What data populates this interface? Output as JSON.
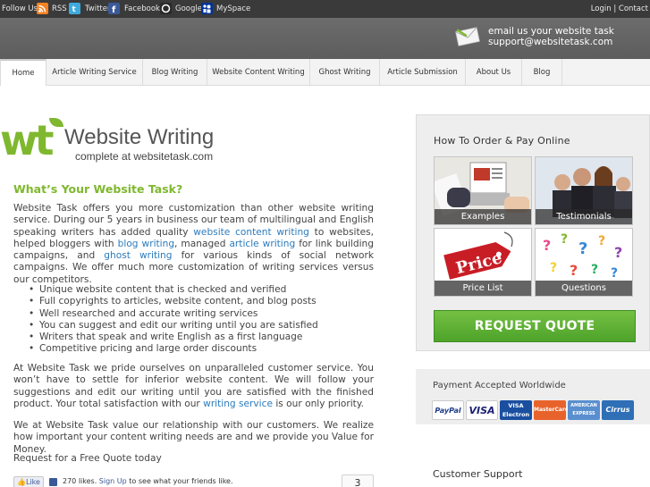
{
  "topbar": {
    "follow_label": "Follow Us:",
    "links": [
      {
        "icon": "rss-icon",
        "label": "RSS",
        "color": "#f58220"
      },
      {
        "icon": "twitter-icon",
        "label": "Twitter",
        "color": "#3fa9de"
      },
      {
        "icon": "facebook-icon",
        "label": "Facebook",
        "color": "#3b5998"
      },
      {
        "icon": "google-icon",
        "label": "Google",
        "color": "#2a2a2a"
      },
      {
        "icon": "myspace-icon",
        "label": "MySpace",
        "color": "#003399"
      }
    ],
    "login": "Login",
    "separator": "|",
    "contact": "Contact"
  },
  "header": {
    "email_line1": "email us your website task",
    "email_line2": "support@websitetask.com"
  },
  "nav": {
    "tabs": [
      {
        "label": "Home",
        "active": true
      },
      {
        "label": "Article Writing Service"
      },
      {
        "label": "Blog Writing"
      },
      {
        "label": "Website Content Writing"
      },
      {
        "label": "Ghost Writing"
      },
      {
        "label": "Article Submission"
      },
      {
        "label": "About Us"
      },
      {
        "label": "Blog"
      }
    ]
  },
  "logo": {
    "mark": "wt",
    "name": "Website Writing",
    "sub": "complete at websitetask.com"
  },
  "main": {
    "heading": "What’s Your Website Task?",
    "p1": {
      "t1": "Website Task offers you more customization than other website writing service. During our 5 years in business our team of multilingual and English speaking writers has added quality ",
      "l1": "website content writing",
      "t2": " to websites, helped bloggers with ",
      "l2": "blog writing",
      "t3": ", managed ",
      "l3": "article writing",
      "t4": " for link building campaigns, and ",
      "l4": "ghost writing",
      "t5": " for various kinds of social network campaigns. We offer much more customization of writing services versus our competitors."
    },
    "bullets": [
      "Unique website content that is checked and verified",
      "Full copyrights to articles, website content, and blog posts",
      "Well researched and accurate writing services",
      "You can suggest and edit our writing until you are satisfied",
      "Writers that speak and write English as a first language",
      "Competitive pricing and large order discounts"
    ],
    "p2": {
      "t1": "At Website Task we pride ourselves on unparalleled customer service. You won’t have to settle for inferior website content. We will follow your suggestions and edit our writing until you are satisfied with the finished product. Your total satisfaction with our ",
      "l1": "writing service",
      "t2": " is our only priority."
    },
    "p3": "We at Website Task value our relationship with our customers. We realize how important your content writing needs are and we provide you Value for Money.",
    "p4": "Request for a Free Quote today",
    "like": {
      "button": "Like",
      "count_text": "270 likes.",
      "signup": "Sign Up",
      "rest": "to see what your friends like.",
      "counter": "3"
    }
  },
  "sidebar": {
    "title": "How To Order & Pay Online",
    "tiles": [
      "Examples",
      "Testimonials",
      "Price List",
      "Questions"
    ],
    "price_tag": "Price",
    "request_button": "REQUEST QUOTE",
    "payment_title": "Payment Accepted Worldwide",
    "cards": [
      {
        "label": "PayPal",
        "color": "#ffffff",
        "text_color": "#1f3c88"
      },
      {
        "label": "VISA",
        "color": "#ffffff",
        "text_color": "#1a1f71"
      },
      {
        "label": "VISA Electron",
        "color": "#1a4fa0",
        "text_color": "#ffffff"
      },
      {
        "label": "MasterCard",
        "color": "#e8632b",
        "text_color": "#ffffff"
      },
      {
        "label": "AMERICAN EXPRESS",
        "color": "#5a8fcf",
        "text_color": "#ffffff"
      },
      {
        "label": "Cirrus",
        "color": "#2e6fb6",
        "text_color": "#ffffff"
      }
    ],
    "support_title": "Customer Support"
  },
  "colors": {
    "accent_green": "#7fb82f",
    "link_blue": "#2b7bbd",
    "button_green": "#5cb030"
  }
}
